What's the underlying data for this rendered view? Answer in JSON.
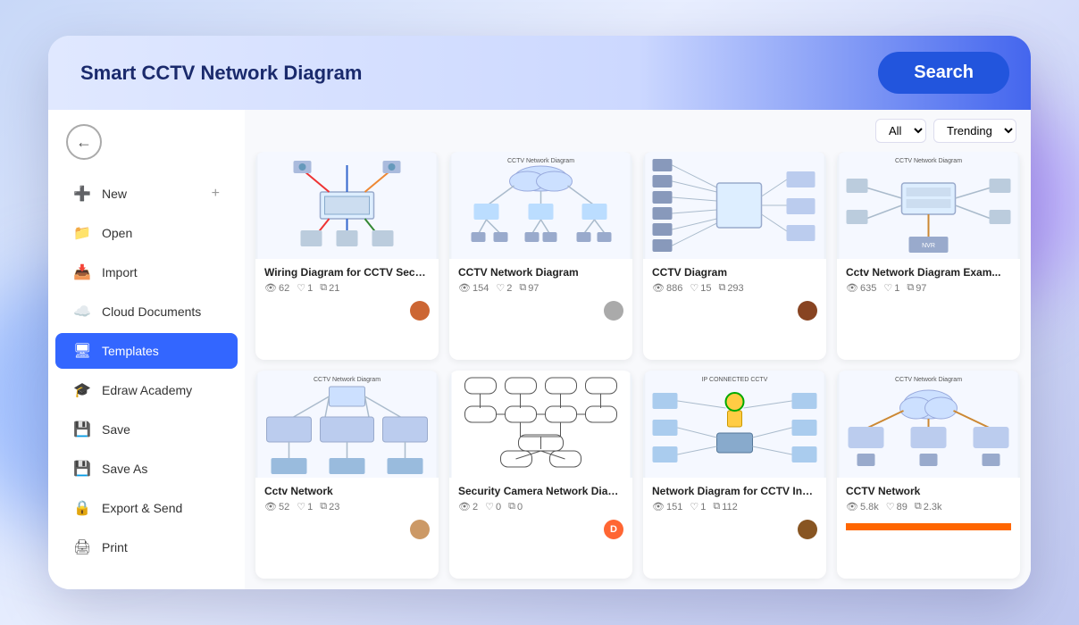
{
  "search": {
    "placeholder": "Smart CCTV Network Diagram",
    "button_label": "Search"
  },
  "sidebar": {
    "back_label": "←",
    "items": [
      {
        "id": "new",
        "label": "New",
        "icon": "➕",
        "extra": "+"
      },
      {
        "id": "open",
        "label": "Open",
        "icon": "📁"
      },
      {
        "id": "import",
        "label": "Import",
        "icon": "📥"
      },
      {
        "id": "cloud",
        "label": "Cloud Documents",
        "icon": "☁️"
      },
      {
        "id": "templates",
        "label": "Templates",
        "icon": "🖥",
        "active": true
      },
      {
        "id": "academy",
        "label": "Edraw Academy",
        "icon": "🎓"
      },
      {
        "id": "save",
        "label": "Save",
        "icon": "💾"
      },
      {
        "id": "saveas",
        "label": "Save As",
        "icon": "💾"
      },
      {
        "id": "export",
        "label": "Export & Send",
        "icon": "🔒"
      },
      {
        "id": "print",
        "label": "Print",
        "icon": "🖨"
      }
    ]
  },
  "toolbar": {
    "filter_options": [
      "All",
      "Trending"
    ],
    "filter_label": "All",
    "sort_label": "Trending"
  },
  "cards": [
    {
      "id": "card1",
      "title": "Wiring Diagram for CCTV Security Camera",
      "views": "62",
      "likes": "1",
      "copies": "21",
      "avatar_color": "#cc6633",
      "avatar_letter": ""
    },
    {
      "id": "card2",
      "title": "CCTV Network Diagram",
      "views": "154",
      "likes": "2",
      "copies": "97",
      "avatar_color": "#aaaaaa",
      "avatar_letter": ""
    },
    {
      "id": "card3",
      "title": "CCTV Diagram",
      "views": "886",
      "likes": "15",
      "copies": "293",
      "avatar_color": "#884422",
      "avatar_letter": ""
    },
    {
      "id": "card4",
      "title": "Cctv Network Diagram Exam...",
      "views": "635",
      "likes": "1",
      "copies": "97",
      "avatar_color": "#aaaaaa",
      "avatar_letter": ""
    },
    {
      "id": "card5",
      "title": "Cctv Network",
      "views": "52",
      "likes": "1",
      "copies": "23",
      "avatar_color": "#cc9966",
      "avatar_letter": ""
    },
    {
      "id": "card6",
      "title": "Security Camera Network Diagram",
      "views": "2",
      "likes": "0",
      "copies": "0",
      "avatar_color": "#ff6633",
      "avatar_letter": "D"
    },
    {
      "id": "card7",
      "title": "Network Diagram for CCTV Installation",
      "views": "151",
      "likes": "1",
      "copies": "112",
      "avatar_color": "#885522",
      "avatar_letter": ""
    },
    {
      "id": "card8",
      "title": "CCTV Network",
      "views": "5.8k",
      "likes": "89",
      "copies": "2.3k",
      "avatar_color": "#aaaaaa",
      "avatar_letter": ""
    }
  ],
  "icons": {
    "eye": "👁",
    "heart": "♡",
    "copy": "⧉",
    "back": "←"
  }
}
